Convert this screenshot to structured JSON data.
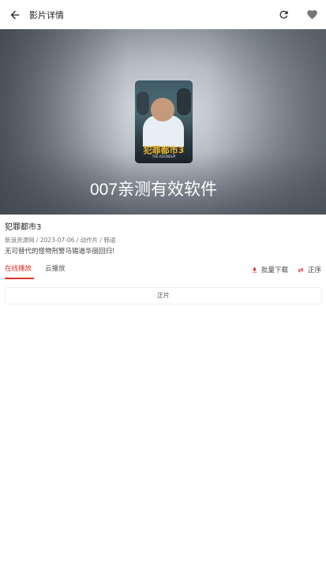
{
  "appbar": {
    "title": "影片详情",
    "back_icon": "arrow-left-icon",
    "refresh_icon": "refresh-icon",
    "favorite_icon": "heart-icon"
  },
  "hero": {
    "overlay_text": "007亲测有效软件",
    "poster_title": "犯罪都市3",
    "poster_subtitle": "THE ROUNDUP"
  },
  "movie": {
    "title": "犯罪都市3",
    "meta": "新浪资源网 / 2023-07-06 / 动作片 / 韩语",
    "description": "无可替代的怪物刑警马锡道华丽回归!"
  },
  "tabs": {
    "online": "在线播放",
    "cloud": "云播放",
    "download": "批量下载",
    "sort": "正序"
  },
  "episodes": [
    "正片"
  ],
  "colors": {
    "accent": "#e0312a",
    "text": "#222222",
    "muted": "#777777"
  }
}
